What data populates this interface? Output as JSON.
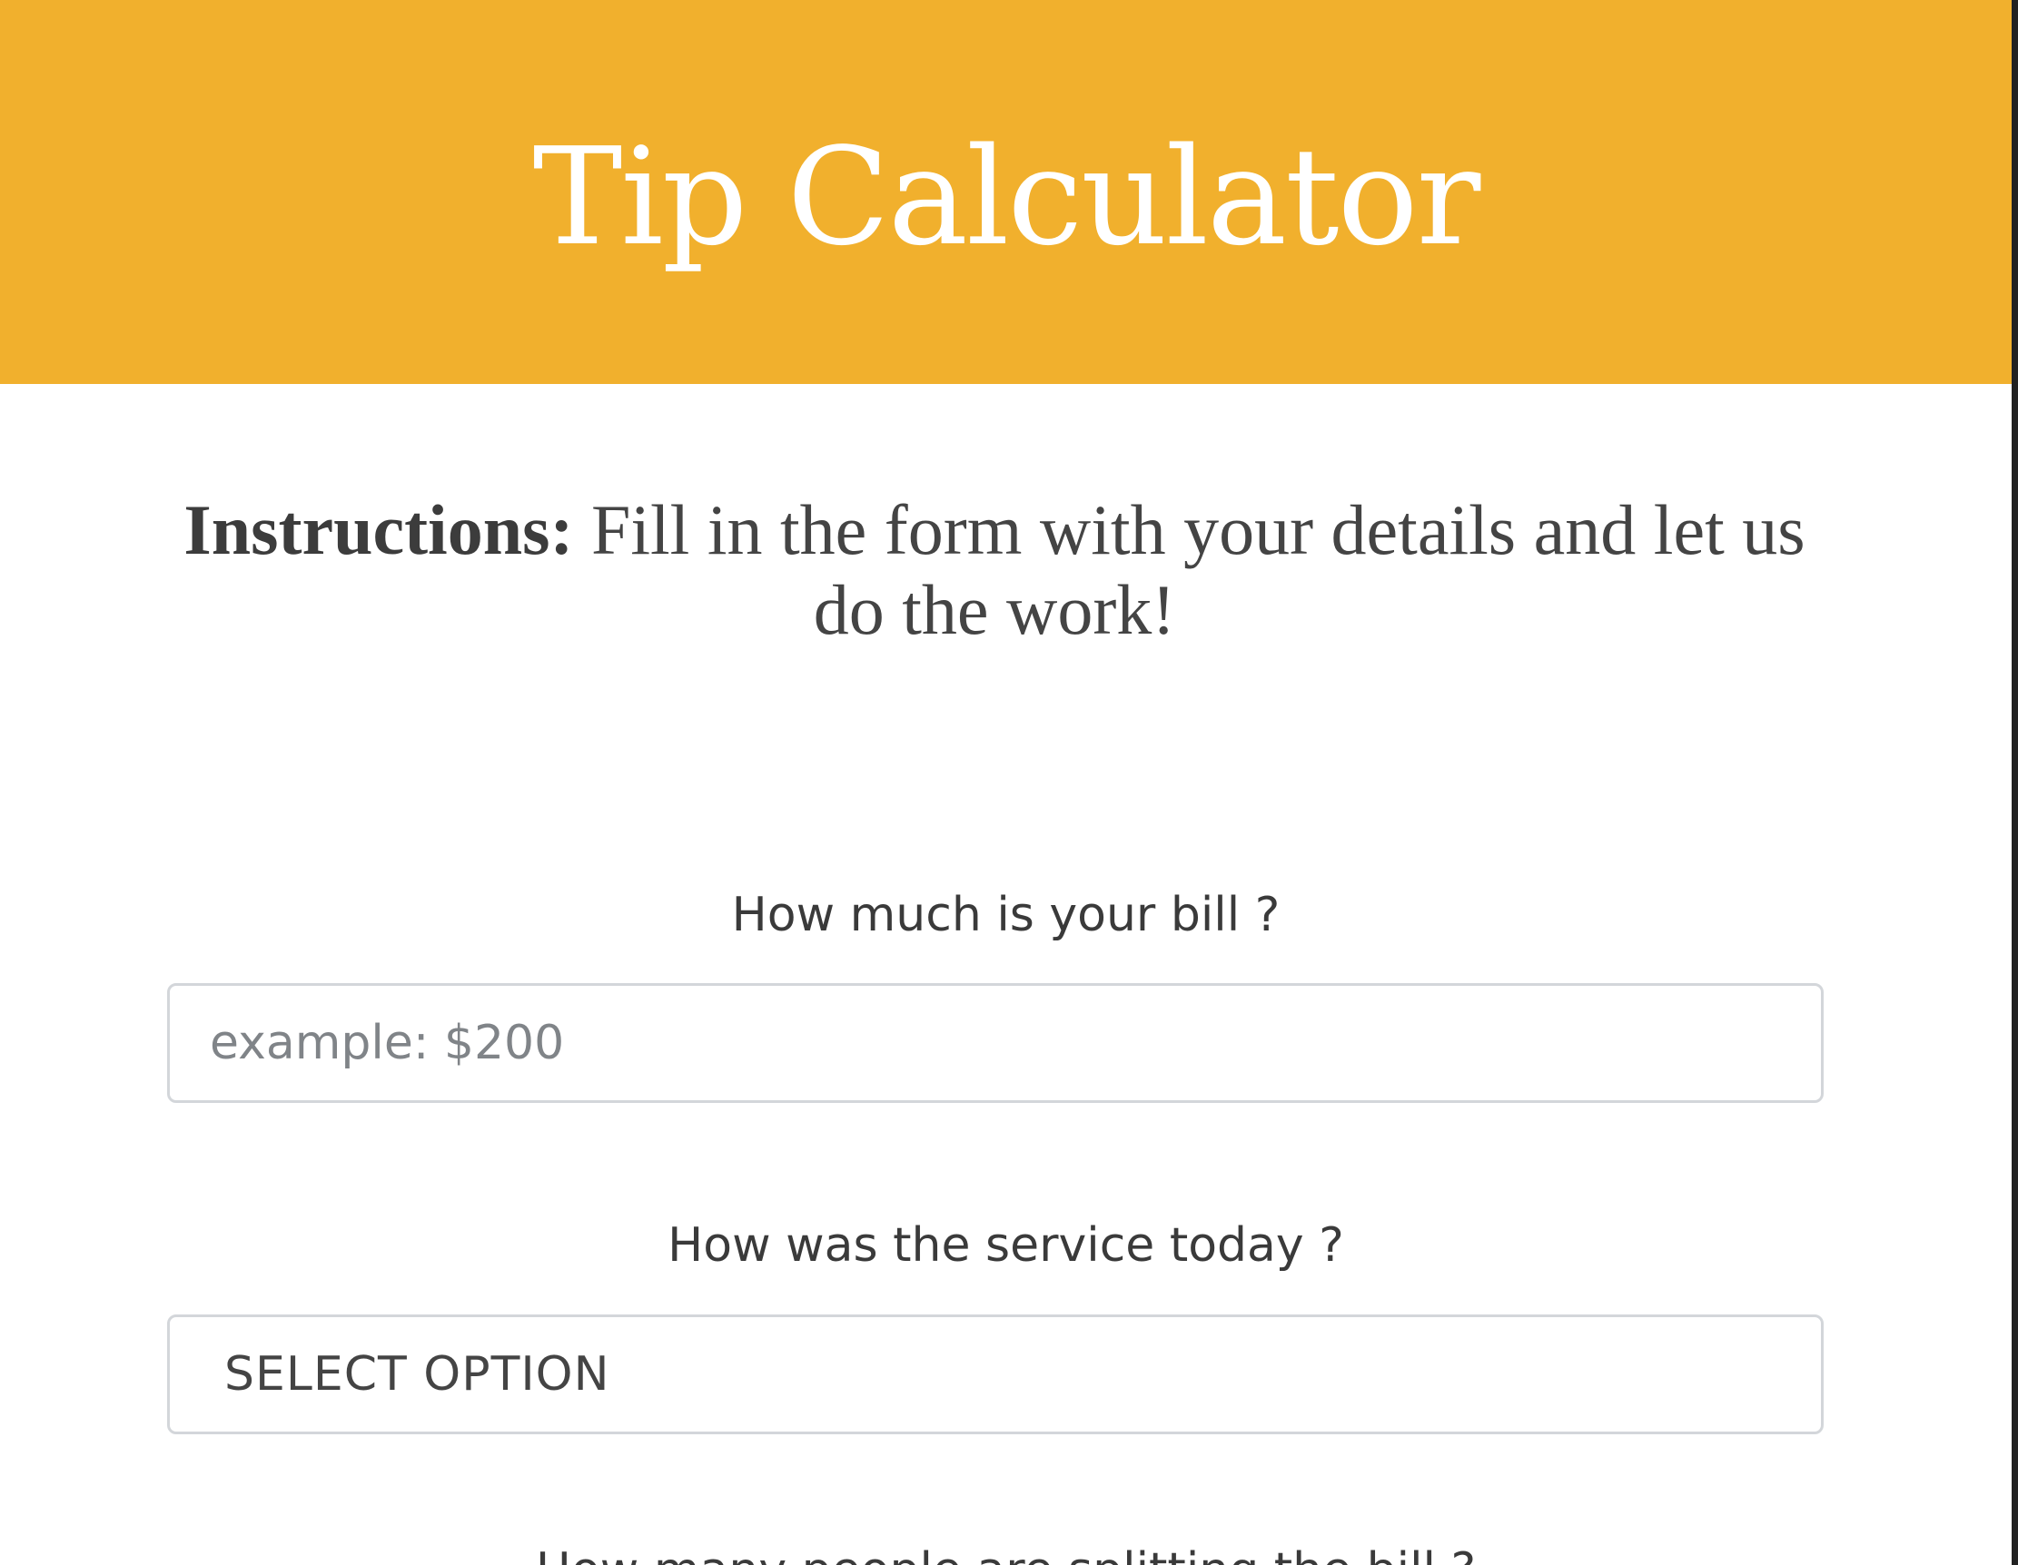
{
  "header": {
    "title": "Tip Calculator"
  },
  "instructions": {
    "label": "Instructions:",
    "text": "Fill in the form with your details and let us do the work!"
  },
  "form": {
    "bill": {
      "label": "How much is your bill ?",
      "placeholder": "example: $200",
      "value": ""
    },
    "service": {
      "label": "How was the service today ?",
      "selected": "SELECT OPTION"
    },
    "split": {
      "label": "How many people are splitting the bill ?"
    }
  },
  "colors": {
    "header_bg": "#f1b02d",
    "header_text": "#ffffff",
    "body_text": "#3a3a3a",
    "field_border": "#d3d6da"
  }
}
